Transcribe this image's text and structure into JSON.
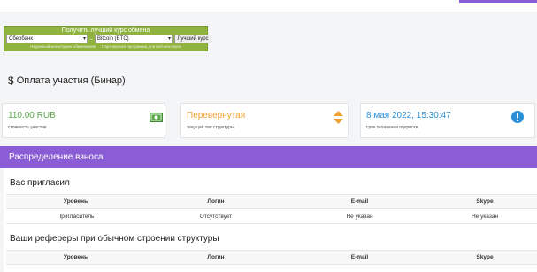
{
  "widget": {
    "title": "Получить лучший курс обмена",
    "from": "Сбербанк",
    "to": "Bitcoin (BTC)",
    "arrow": "→",
    "button": "Лучший курс",
    "links": [
      "Надежный мониторинг обменников",
      "Партнерская программа для веб-мастеров"
    ]
  },
  "page": {
    "title_icon": "$",
    "title": "Оплата участия (Бинар)"
  },
  "cards": [
    {
      "value": "110.00 RUB",
      "sub": "стоимость участия",
      "icon": "money-icon",
      "color": "#5aa84a"
    },
    {
      "value": "Перевернутая",
      "sub": "текущий тип структуры",
      "icon": "sort-arrows-icon",
      "color": "#f0a030"
    },
    {
      "value": "8 мая 2022, 15:30:47",
      "sub": "срок окончания подписки",
      "icon": "alert-circle-icon",
      "color": "#2a8fd6"
    }
  ],
  "section": {
    "title": "Распределение взноса"
  },
  "invited": {
    "heading": "Вас пригласил",
    "columns": [
      "Уровень",
      "Логин",
      "E-mail",
      "Skype"
    ],
    "rows": [
      [
        "Пригласитель",
        "Отсутствует",
        "Не указан",
        "Не указан"
      ]
    ]
  },
  "referrals": {
    "heading": "Ваши рефереры при обычном строении структуры",
    "columns": [
      "Уровень",
      "Логин",
      "E-mail",
      "Skype"
    ]
  },
  "colors": {
    "accent": "#8a5cd6",
    "widget": "#8fb33e"
  }
}
